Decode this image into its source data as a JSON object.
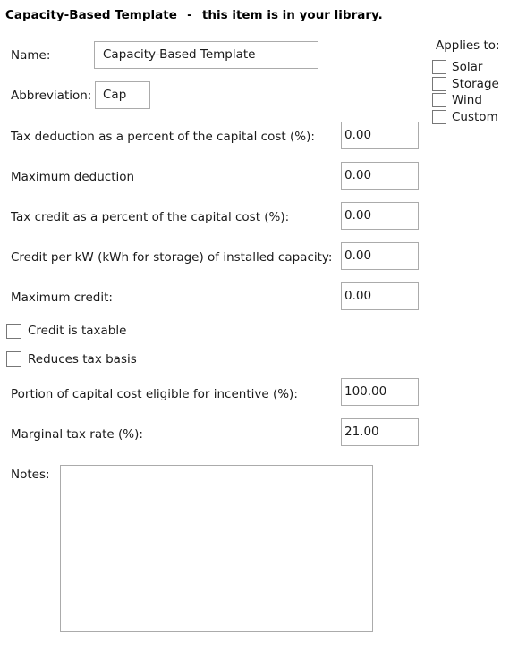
{
  "header": {
    "item_name": "Capacity-Based Template",
    "separator": "-",
    "library_status": "this item is in your library."
  },
  "fields": {
    "name": {
      "label": "Name:",
      "value": "Capacity-Based Template"
    },
    "abbreviation": {
      "label": "Abbreviation:",
      "value": "Cap"
    },
    "tax_deduction_percent": {
      "label": "Tax deduction as a percent of the capital cost (%):",
      "value": "0.00"
    },
    "maximum_deduction": {
      "label": "Maximum deduction",
      "value": "0.00"
    },
    "tax_credit_percent": {
      "label": "Tax credit as a percent of the capital cost (%):",
      "value": "0.00"
    },
    "credit_per_kw": {
      "label": "Credit per kW (kWh for storage) of installed capacity:",
      "value": "0.00"
    },
    "maximum_credit": {
      "label": "Maximum credit:",
      "value": "0.00"
    },
    "portion_eligible": {
      "label": "Portion of capital cost eligible for incentive (%):",
      "value": "100.00"
    },
    "marginal_tax_rate": {
      "label": "Marginal tax rate (%):",
      "value": "21.00"
    },
    "notes": {
      "label": "Notes:",
      "value": ""
    }
  },
  "options": {
    "credit_is_taxable": {
      "label": "Credit is taxable",
      "checked": false
    },
    "reduces_tax_basis": {
      "label": "Reduces tax basis",
      "checked": false
    }
  },
  "applies_to": {
    "label": "Applies to:",
    "items": [
      {
        "label": "Solar",
        "checked": false
      },
      {
        "label": "Storage",
        "checked": false
      },
      {
        "label": "Wind",
        "checked": false
      },
      {
        "label": "Custom",
        "checked": false
      }
    ]
  },
  "colors": {
    "input_border": "#ababab",
    "checkbox_border": "#777777",
    "text": "#1a1a1a"
  }
}
